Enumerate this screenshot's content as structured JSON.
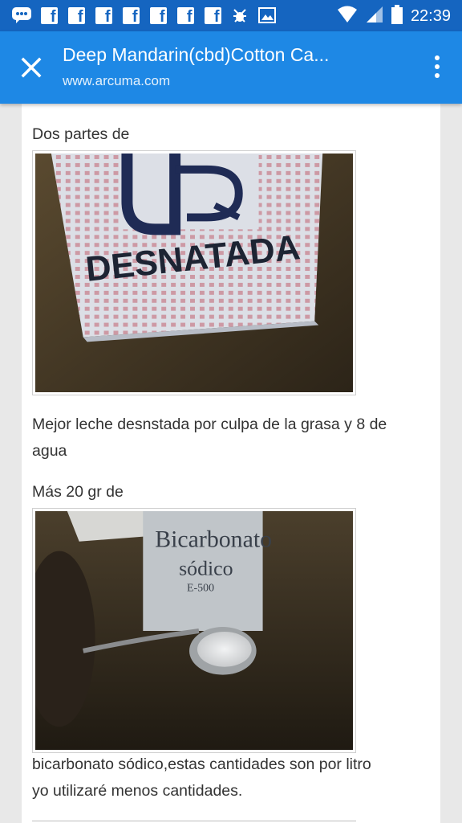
{
  "status_bar": {
    "time": "22:39",
    "notification_icons": [
      "chat-icon",
      "facebook-icon",
      "facebook-icon",
      "facebook-icon",
      "facebook-icon",
      "facebook-icon",
      "facebook-icon",
      "facebook-icon",
      "bug-icon",
      "image-icon"
    ],
    "facebook_glyph": "f"
  },
  "app_bar": {
    "title": "Deep Mandarin(cbd)Cotton Ca...",
    "url": "www.arcuma.com"
  },
  "article": {
    "p1": "Dos partes de",
    "image1_label": "DESNATADA",
    "p2_line1": "Mejor leche desnstada por culpa de la grasa y 8 de",
    "p2_line2": "agua",
    "p3": "Más 20 gr de",
    "image2_label_line1": "Bicarbonato",
    "image2_label_line2": "sódico",
    "image2_label_line3": "E-500",
    "p4_line1": "bicarbonato sódico,estas cantidades son por litro",
    "p4_line2": "yo utilizaré menos cantidades."
  },
  "colors": {
    "status_bar": "#1565c0",
    "app_bar": "#1e88e5",
    "text": "#333333"
  }
}
